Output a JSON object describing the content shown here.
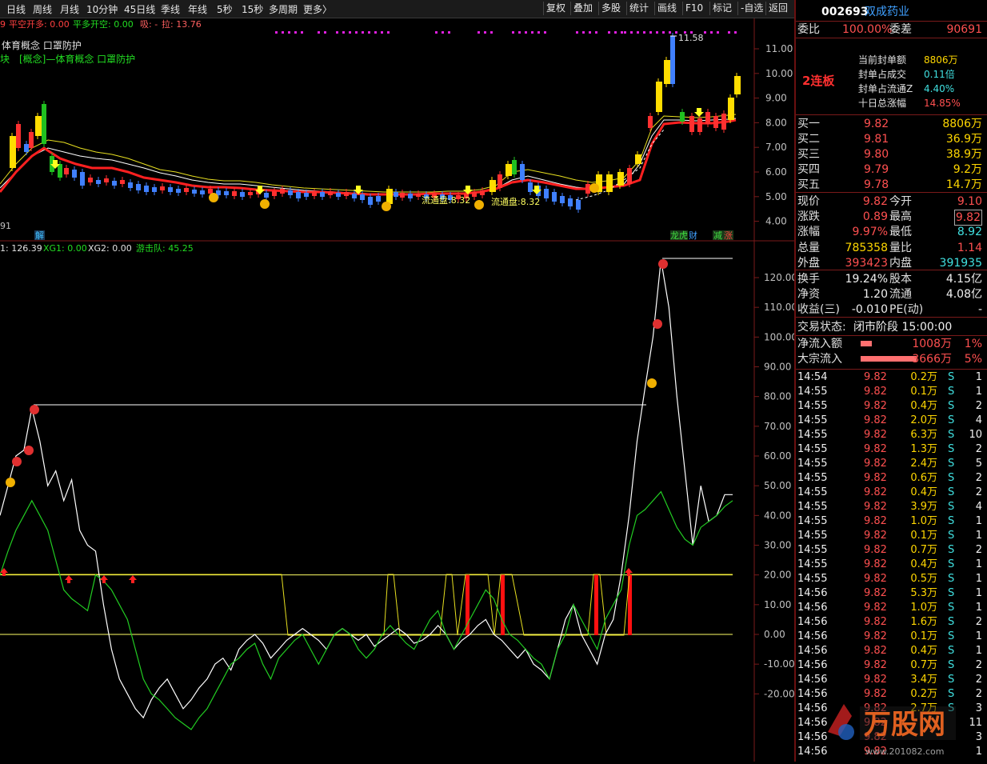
{
  "topbar": {
    "tabs": [
      "日线",
      "周线",
      "月线",
      "10分钟",
      "45日线",
      "季线",
      "年线",
      "5秒",
      "15秒",
      "多周期",
      "更多〉"
    ],
    "buttons": [
      "复权",
      "叠加",
      "多股",
      "统计",
      "画线",
      "F10",
      "标记",
      "-自选",
      "返回"
    ]
  },
  "main_chart": {
    "label_line1_prefix": "9",
    "label_line1_a": "平空开多: 0.00",
    "label_line1_b": "平多开空: 0.00",
    "label_line1_c": "吸: -",
    "label_line1_d": "拉: 13.76",
    "label_line2": "体育概念 口罩防护",
    "label_line3": "块　[概念]—体育概念 口罩防护",
    "high_label": "11.58",
    "low_label": "91",
    "annot1": "流通盘:8.32",
    "annot2": "流通盘:8.32",
    "badge_left": "解",
    "badge_right": [
      "龙虎",
      "财",
      "减",
      "涨"
    ],
    "price_ticks": [
      "11.00",
      "10.00",
      "9.00",
      "8.00",
      "7.00",
      "6.00",
      "5.00",
      "4.00"
    ]
  },
  "indicator": {
    "label_a": "1: 126.39",
    "label_b": "XG1: 0.00",
    "label_c": "XG2: 0.00",
    "label_d": "游击队: 45.25",
    "ticks": [
      "120.00",
      "110.00",
      "100.00",
      "90.00",
      "80.00",
      "70.00",
      "60.00",
      "50.00",
      "40.00",
      "30.00",
      "20.00",
      "10.00",
      "0.00",
      "-10.00",
      "-20.00"
    ]
  },
  "chart_data": {
    "type": "line",
    "panel": "indicator",
    "ylim": [
      -25,
      130
    ],
    "series": [
      {
        "color": "#ffffff",
        "values": [
          40,
          50,
          60,
          62,
          76,
          65,
          50,
          55,
          45,
          52,
          35,
          30,
          28,
          10,
          -5,
          -15,
          -20,
          -25,
          -28,
          -22,
          -18,
          -15,
          -20,
          -25,
          -22,
          -18,
          -15,
          -10,
          -8,
          -12,
          -5,
          -2,
          0,
          -3,
          -8,
          -5,
          -2,
          0,
          2,
          0,
          -2,
          -5,
          0,
          2,
          0,
          -2,
          0,
          -4,
          -2,
          0,
          2,
          0,
          -3,
          -2,
          0,
          3,
          0,
          -5,
          -2,
          0,
          3,
          5,
          0,
          -2,
          -5,
          -8,
          -5,
          -10,
          -12,
          -15,
          -5,
          5,
          10,
          0,
          -5,
          -10,
          0,
          5,
          20,
          40,
          65,
          83,
          100,
          126,
          110,
          80,
          55,
          30,
          50,
          38,
          40,
          47,
          47
        ]
      },
      {
        "color": "#22cc22",
        "values": [
          20,
          28,
          35,
          40,
          45,
          40,
          35,
          25,
          15,
          12,
          10,
          8,
          20,
          18,
          15,
          10,
          5,
          -5,
          -15,
          -20,
          -22,
          -25,
          -28,
          -30,
          -32,
          -28,
          -25,
          -20,
          -15,
          -10,
          -8,
          -5,
          -3,
          -10,
          -15,
          -8,
          -5,
          -2,
          0,
          -5,
          -10,
          -5,
          0,
          2,
          0,
          -5,
          -8,
          -5,
          0,
          3,
          0,
          -3,
          -5,
          0,
          5,
          8,
          0,
          -5,
          0,
          5,
          10,
          15,
          12,
          5,
          0,
          -2,
          -5,
          -8,
          -10,
          -15,
          -5,
          0,
          10,
          5,
          0,
          -5,
          5,
          10,
          15,
          30,
          40,
          42,
          45,
          48,
          42,
          36,
          32,
          30,
          36,
          38,
          40,
          43,
          45
        ]
      }
    ],
    "levels": [
      {
        "name": "",
        "value": 20,
        "color": "#ffff66"
      },
      {
        "name": "",
        "value": 0,
        "color": "#ffff66"
      }
    ],
    "ytick_labels": [
      "120.00",
      "110.00",
      "100.00",
      "90.00",
      "80.00",
      "70.00",
      "60.00",
      "50.00",
      "40.00",
      "30.00",
      "20.00",
      "10.00",
      "0.00",
      "-10.00",
      "-20.00"
    ]
  },
  "quote": {
    "code": "002693",
    "name": "双成药业",
    "weibi_label": "委比",
    "weibi_value": "100.00%",
    "weicha_label": "委差",
    "weicha_value": "90691",
    "lianban": "2连板",
    "seal_rows": [
      {
        "label": "当前封单额",
        "value": "8806万"
      },
      {
        "label": "封单占成交",
        "value": "0.11倍"
      },
      {
        "label": "封单占流通Z",
        "value": "4.40%"
      },
      {
        "label": "十日总涨幅",
        "value": "14.85%"
      }
    ],
    "bids": [
      {
        "label": "买一",
        "price": "9.82",
        "vol": "8806万"
      },
      {
        "label": "买二",
        "price": "9.81",
        "vol": "36.9万"
      },
      {
        "label": "买三",
        "price": "9.80",
        "vol": "38.9万"
      },
      {
        "label": "买四",
        "price": "9.79",
        "vol": "9.2万"
      },
      {
        "label": "买五",
        "price": "9.78",
        "vol": "14.7万"
      }
    ],
    "stats": [
      {
        "l1": "现价",
        "v1": "9.82",
        "c1": "red",
        "l2": "今开",
        "v2": "9.10",
        "c2": "red"
      },
      {
        "l1": "涨跌",
        "v1": "0.89",
        "c1": "red",
        "l2": "最高",
        "v2": "9.82",
        "c2": "red"
      },
      {
        "l1": "涨幅",
        "v1": "9.97%",
        "c1": "red",
        "l2": "最低",
        "v2": "8.92",
        "c2": "cyan"
      },
      {
        "l1": "总量",
        "v1": "785358",
        "c1": "yel",
        "l2": "量比",
        "v2": "1.14",
        "c2": "red"
      },
      {
        "l1": "外盘",
        "v1": "393423",
        "c1": "red",
        "l2": "内盘",
        "v2": "391935",
        "c2": "cyan"
      }
    ],
    "stats2": [
      {
        "l1": "换手",
        "v1": "19.24%",
        "l2": "股本",
        "v2": "4.15亿"
      },
      {
        "l1": "净资",
        "v1": "1.20",
        "l2": "流通",
        "v2": "4.08亿"
      },
      {
        "l1": "收益(三)",
        "v1": "-0.010",
        "l2": "PE(动)",
        "v2": "-"
      }
    ],
    "trade_state_label": "交易状态:",
    "trade_state_value": "闭市阶段 15:00:00",
    "flows": [
      {
        "label": "净流入额",
        "value": "1008万",
        "pct": "1%",
        "fill": 0.2
      },
      {
        "label": "大宗流入",
        "value": "3666万",
        "pct": "5%",
        "fill": 1.0
      }
    ],
    "ticks": [
      {
        "t": "14:54",
        "p": "9.82",
        "v": "0.2万",
        "s": "S",
        "n": "1"
      },
      {
        "t": "14:55",
        "p": "9.82",
        "v": "0.1万",
        "s": "S",
        "n": "1"
      },
      {
        "t": "14:55",
        "p": "9.82",
        "v": "0.4万",
        "s": "S",
        "n": "2"
      },
      {
        "t": "14:55",
        "p": "9.82",
        "v": "2.0万",
        "s": "S",
        "n": "4"
      },
      {
        "t": "14:55",
        "p": "9.82",
        "v": "6.3万",
        "s": "S",
        "n": "10"
      },
      {
        "t": "14:55",
        "p": "9.82",
        "v": "1.3万",
        "s": "S",
        "n": "2"
      },
      {
        "t": "14:55",
        "p": "9.82",
        "v": "2.4万",
        "s": "S",
        "n": "5"
      },
      {
        "t": "14:55",
        "p": "9.82",
        "v": "0.6万",
        "s": "S",
        "n": "2"
      },
      {
        "t": "14:55",
        "p": "9.82",
        "v": "0.4万",
        "s": "S",
        "n": "2"
      },
      {
        "t": "14:55",
        "p": "9.82",
        "v": "3.9万",
        "s": "S",
        "n": "4"
      },
      {
        "t": "14:55",
        "p": "9.82",
        "v": "1.0万",
        "s": "S",
        "n": "1"
      },
      {
        "t": "14:55",
        "p": "9.82",
        "v": "0.1万",
        "s": "S",
        "n": "1"
      },
      {
        "t": "14:55",
        "p": "9.82",
        "v": "0.7万",
        "s": "S",
        "n": "2"
      },
      {
        "t": "14:55",
        "p": "9.82",
        "v": "0.4万",
        "s": "S",
        "n": "1"
      },
      {
        "t": "14:55",
        "p": "9.82",
        "v": "0.5万",
        "s": "S",
        "n": "1"
      },
      {
        "t": "14:56",
        "p": "9.82",
        "v": "5.3万",
        "s": "S",
        "n": "1"
      },
      {
        "t": "14:56",
        "p": "9.82",
        "v": "1.0万",
        "s": "S",
        "n": "1"
      },
      {
        "t": "14:56",
        "p": "9.82",
        "v": "1.6万",
        "s": "S",
        "n": "2"
      },
      {
        "t": "14:56",
        "p": "9.82",
        "v": "0.1万",
        "s": "S",
        "n": "1"
      },
      {
        "t": "14:56",
        "p": "9.82",
        "v": "0.4万",
        "s": "S",
        "n": "1"
      },
      {
        "t": "14:56",
        "p": "9.82",
        "v": "0.7万",
        "s": "S",
        "n": "2"
      },
      {
        "t": "14:56",
        "p": "9.82",
        "v": "3.4万",
        "s": "S",
        "n": "2"
      },
      {
        "t": "14:56",
        "p": "9.82",
        "v": "0.2万",
        "s": "S",
        "n": "2"
      },
      {
        "t": "14:56",
        "p": "9.82",
        "v": "2.7万",
        "s": "S",
        "n": "3"
      },
      {
        "t": "14:56",
        "p": "9.82",
        "v": "",
        "s": "",
        "n": "11"
      },
      {
        "t": "14:56",
        "p": "9.82",
        "v": "",
        "s": "",
        "n": "3"
      },
      {
        "t": "14:56",
        "p": "9.82",
        "v": "",
        "s": "",
        "n": "1"
      }
    ],
    "watermark_text": "万股网",
    "watermark_url": "www.201082.com"
  }
}
